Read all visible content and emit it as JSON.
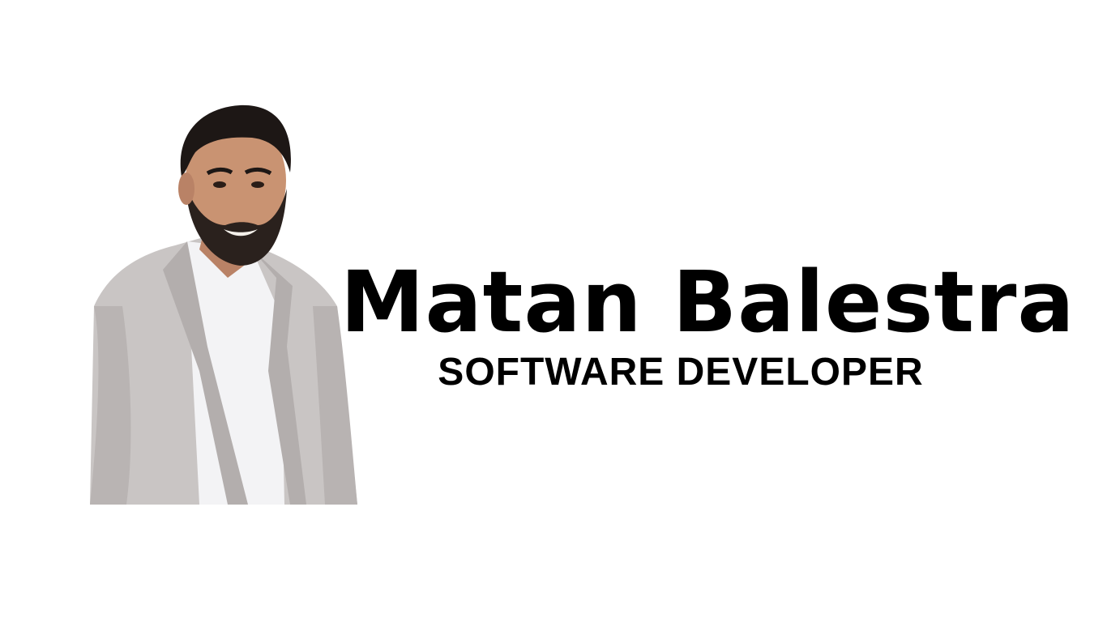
{
  "profile": {
    "name": "Matan Balestra",
    "title": "SOFTWARE DEVELOPER"
  },
  "portrait": {
    "description_icon": "person-photo",
    "jacket_color": "#c9c5c4",
    "shirt_color": "#f3f3f5",
    "hair_color": "#1d1715",
    "skin_color": "#c99372"
  },
  "colors": {
    "background": "#ffffff",
    "text": "#000000"
  }
}
